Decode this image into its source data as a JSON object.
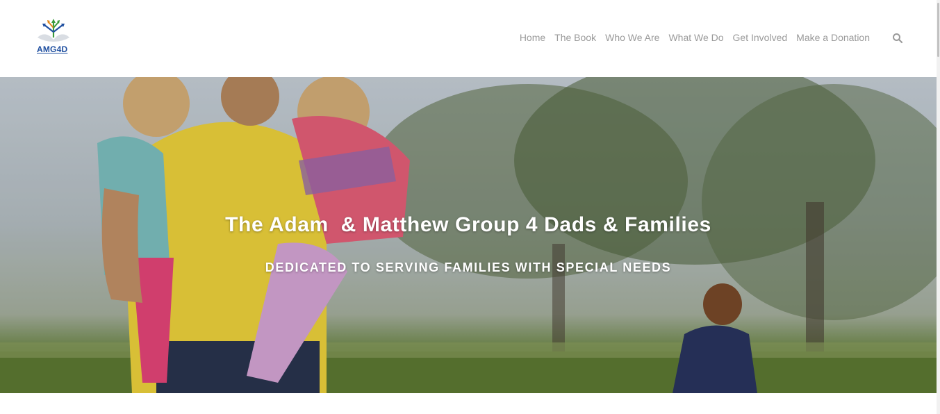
{
  "logo": {
    "text": "AMG4D",
    "icon": "tree-hands-logo-icon"
  },
  "nav": {
    "items": [
      {
        "label": "Home"
      },
      {
        "label": "The Book"
      },
      {
        "label": "Who We Are"
      },
      {
        "label": "What We Do"
      },
      {
        "label": "Get Involved"
      },
      {
        "label": "Make a Donation"
      }
    ],
    "search_icon": "search-icon"
  },
  "hero": {
    "title": "The Adam  & Matthew Group 4 Dads & Families",
    "subtitle": "DEDICATED TO SERVING FAMILIES WITH SPECIAL NEEDS",
    "image": "father-carrying-children-photo"
  },
  "colors": {
    "nav_text": "#9a9a9a",
    "logo_blue": "#1f4fa0",
    "logo_green": "#3a9a3a",
    "logo_orange": "#e48a1c",
    "hero_text": "#ffffff",
    "shirt_yellow": "#f1d53d"
  }
}
